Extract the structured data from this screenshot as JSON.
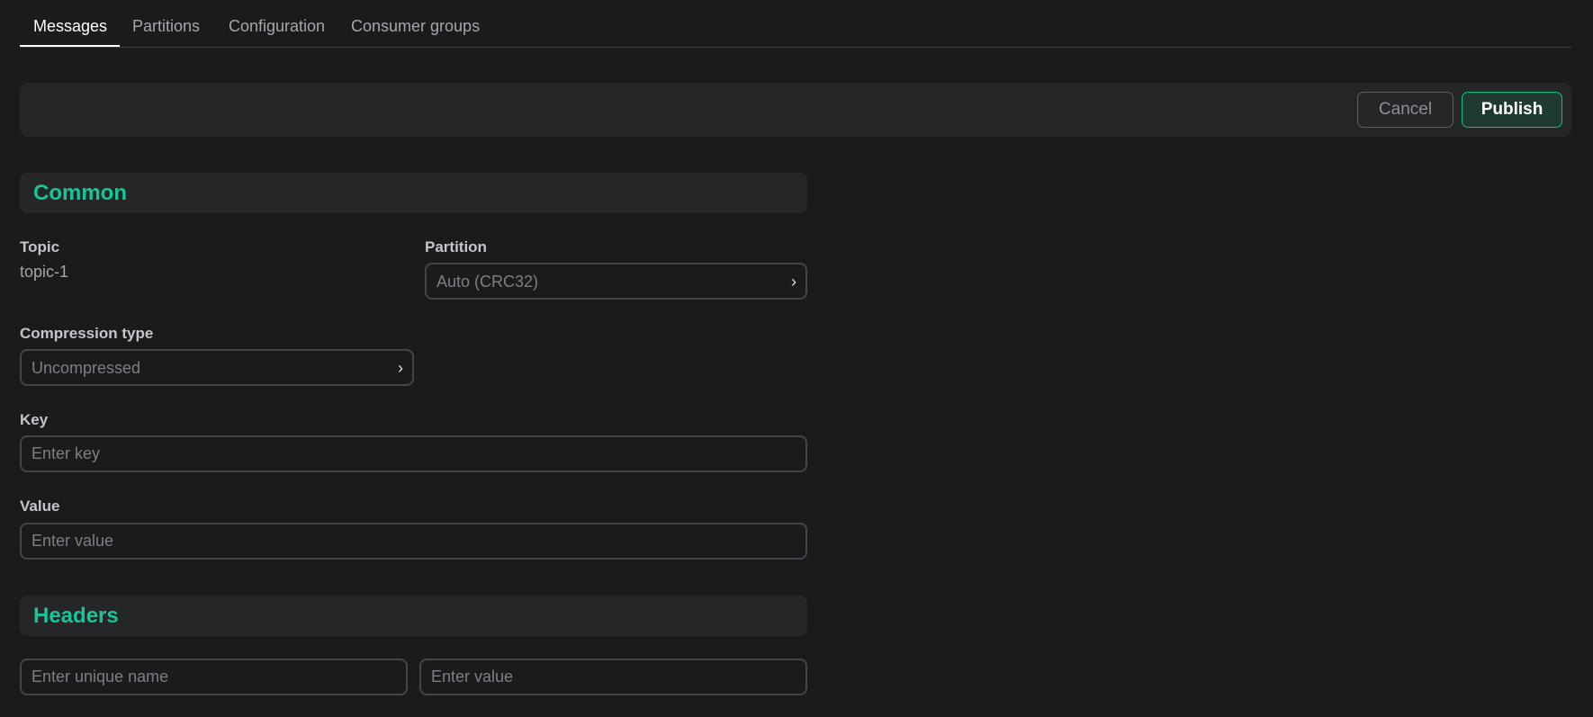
{
  "tabs": [
    {
      "label": "Messages",
      "active": true
    },
    {
      "label": "Partitions",
      "active": false
    },
    {
      "label": "Configuration",
      "active": false
    },
    {
      "label": "Consumer groups",
      "active": false
    }
  ],
  "toolbar": {
    "cancel_label": "Cancel",
    "publish_label": "Publish"
  },
  "common": {
    "title": "Common",
    "topic_label": "Topic",
    "topic_value": "topic-1",
    "partition_label": "Partition",
    "partition_value": "Auto (CRC32)",
    "compression_label": "Compression type",
    "compression_value": "Uncompressed",
    "key_label": "Key",
    "key_placeholder": "Enter key",
    "value_label": "Value",
    "value_placeholder": "Enter value"
  },
  "headers": {
    "title": "Headers",
    "name_placeholder": "Enter unique name",
    "value_placeholder": "Enter value"
  },
  "icons": {
    "select_chevron": "chevron-right-icon"
  },
  "colors": {
    "accent": "#16c59a",
    "background": "#1b1b1c",
    "panel": "#252628",
    "publish_border": "#00c48c"
  }
}
